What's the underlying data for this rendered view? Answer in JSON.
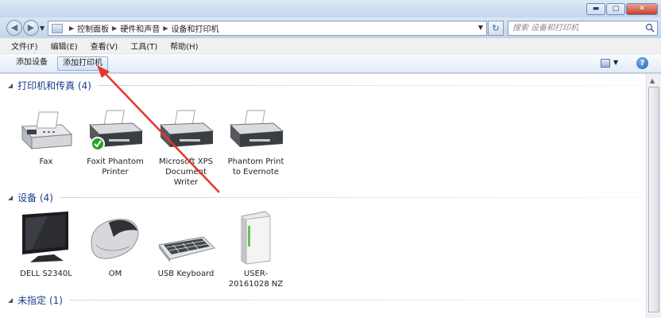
{
  "window": {
    "buttons": {
      "minimize": "▬",
      "maximize": "□",
      "close": "✕"
    }
  },
  "address": {
    "crumbs": [
      "控制面板",
      "硬件和声音",
      "设备和打印机"
    ],
    "search_placeholder": "搜索 设备和打印机",
    "refresh": "↻"
  },
  "menu": {
    "items": [
      "文件(F)",
      "编辑(E)",
      "查看(V)",
      "工具(T)",
      "帮助(H)"
    ]
  },
  "toolbar": {
    "add_device": "添加设备",
    "add_printer": "添加打印机",
    "help": "?"
  },
  "groups": {
    "printers": {
      "title": "打印机和传真 (4)",
      "items": [
        {
          "label": "Fax"
        },
        {
          "label": "Foxit Phantom Printer",
          "default": true
        },
        {
          "label": "Microsoft XPS Document Writer"
        },
        {
          "label": "Phantom Print to Evernote"
        }
      ]
    },
    "devices": {
      "title": "设备 (4)",
      "items": [
        {
          "label": "DELL S2340L"
        },
        {
          "label": "OM"
        },
        {
          "label": "USB Keyboard"
        },
        {
          "label": "USER-20161028 NZ"
        }
      ]
    },
    "unspecified": {
      "title": "未指定 (1)"
    }
  },
  "colors": {
    "group_title": "#1a3c8c",
    "annotation_arrow": "#e8352b",
    "default_check": "#2aa02a"
  }
}
